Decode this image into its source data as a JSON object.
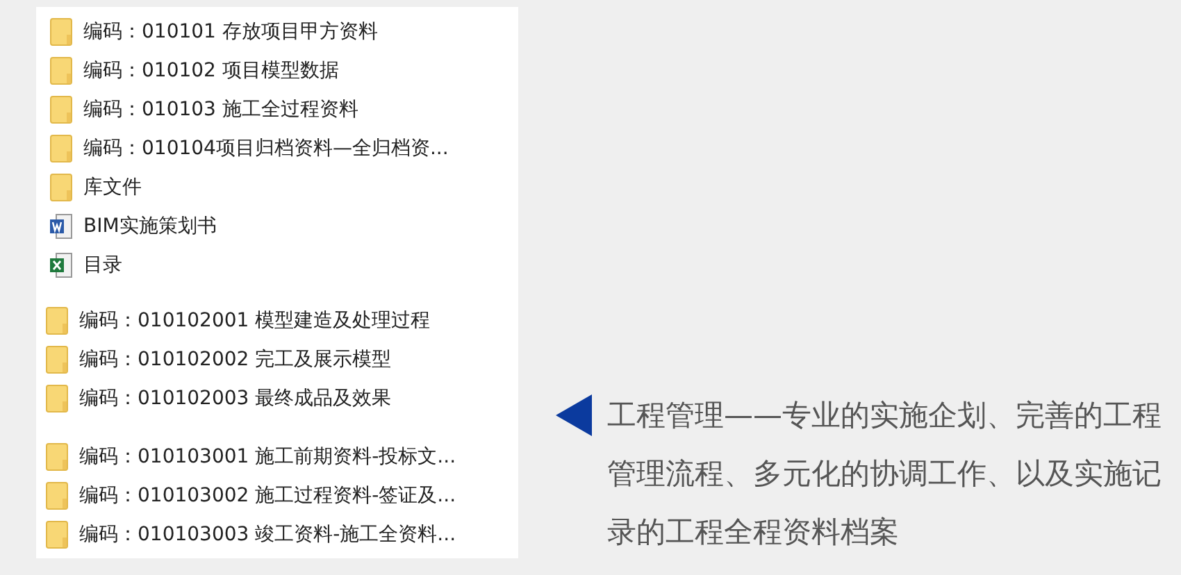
{
  "file_groups": [
    {
      "items": [
        {
          "kind": "folder",
          "label": "编码：010101 存放项目甲方资料"
        },
        {
          "kind": "folder",
          "label": "编码：010102 项目模型数据"
        },
        {
          "kind": "folder",
          "label": "编码：010103 施工全过程资料"
        },
        {
          "kind": "folder",
          "label": "编码：010104项目归档资料—全归档资..."
        },
        {
          "kind": "folder",
          "label": "库文件"
        },
        {
          "kind": "word",
          "label": "BIM实施策划书"
        },
        {
          "kind": "excel",
          "label": "目录"
        }
      ]
    },
    {
      "items": [
        {
          "kind": "folder",
          "label": "编码：010102001 模型建造及处理过程"
        },
        {
          "kind": "folder",
          "label": "编码：010102002 完工及展示模型"
        },
        {
          "kind": "folder",
          "label": "编码：010102003 最终成品及效果"
        }
      ]
    },
    {
      "items": [
        {
          "kind": "folder",
          "label": "编码：010103001 施工前期资料-投标文..."
        },
        {
          "kind": "folder",
          "label": "编码：010103002 施工过程资料-签证及..."
        },
        {
          "kind": "folder",
          "label": "编码：010103003 竣工资料-施工全资料..."
        }
      ]
    }
  ],
  "callout": {
    "text": "工程管理——专业的实施企划、完善的工程管理流程、多元化的协调工作、以及实施记录的工程全程资料档案"
  }
}
